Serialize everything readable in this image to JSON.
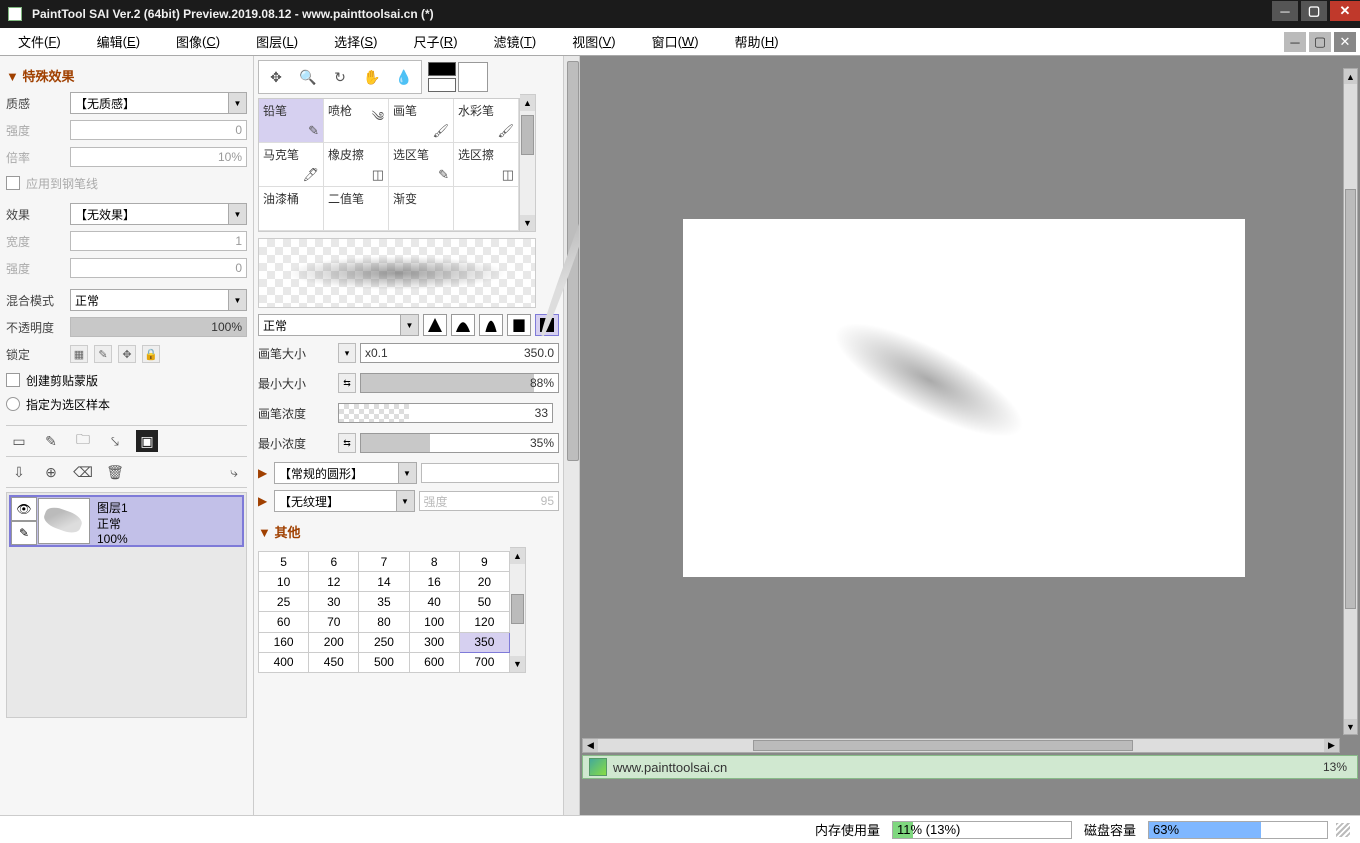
{
  "window": {
    "title": "PaintTool SAI Ver.2 (64bit) Preview.2019.08.12 - www.painttoolsai.cn (*)"
  },
  "menu": {
    "file": {
      "label": "文件",
      "mn": "F"
    },
    "edit": {
      "label": "编辑",
      "mn": "E"
    },
    "image": {
      "label": "图像",
      "mn": "C"
    },
    "layer": {
      "label": "图层",
      "mn": "L"
    },
    "select": {
      "label": "选择",
      "mn": "S"
    },
    "ruler": {
      "label": "尺子",
      "mn": "R"
    },
    "filter": {
      "label": "滤镜",
      "mn": "T"
    },
    "view": {
      "label": "视图",
      "mn": "V"
    },
    "window": {
      "label": "窗口",
      "mn": "W"
    },
    "help": {
      "label": "帮助",
      "mn": "H"
    }
  },
  "left": {
    "special_header": "特殊效果",
    "texture_label": "质感",
    "texture_value": "【无质感】",
    "intensity_label": "强度",
    "intensity_value": "0",
    "scale_label": "倍率",
    "scale_value": "10%",
    "apply_pen_label": "应用到钢笔线",
    "effect_label": "效果",
    "effect_value": "【无效果】",
    "width_label": "宽度",
    "width_value": "1",
    "intensity2_label": "强度",
    "intensity2_value": "0",
    "blend_label": "混合模式",
    "blend_value": "正常",
    "opacity_label": "不透明度",
    "opacity_value": "100%",
    "lock_label": "锁定",
    "clip_label": "创建剪贴蒙版",
    "selsrc_label": "指定为选区样本",
    "layer": {
      "name": "图层1",
      "mode": "正常",
      "opacity": "100%"
    }
  },
  "mid": {
    "brushes": {
      "r1c1": "铅笔",
      "r1c2": "喷枪",
      "r1c3": "画笔",
      "r1c4": "水彩笔",
      "r2c1": "马克笔",
      "r2c2": "橡皮擦",
      "r2c3": "选区笔",
      "r2c4": "选区擦",
      "r3c1": "油漆桶",
      "r3c2": "二值笔",
      "r3c3": "渐变"
    },
    "mode_value": "正常",
    "brush_size_label": "画笔大小",
    "brush_size_prefix": "x0.1",
    "brush_size_value": "350.0",
    "min_size_label": "最小大小",
    "min_size_value": "88%",
    "density_label": "画笔浓度",
    "density_value": "33",
    "min_density_label": "最小浓度",
    "min_density_value": "35%",
    "shape_label": "【常规的圆形】",
    "texture_label": "【无纹理】",
    "texture_intensity_label": "强度",
    "texture_intensity_value": "95",
    "other_header": "其他",
    "sizes": [
      [
        "5",
        "6",
        "7",
        "8",
        "9"
      ],
      [
        "10",
        "12",
        "14",
        "16",
        "20"
      ],
      [
        "25",
        "30",
        "35",
        "40",
        "50"
      ],
      [
        "60",
        "70",
        "80",
        "100",
        "120"
      ],
      [
        "160",
        "200",
        "250",
        "300",
        "350"
      ],
      [
        "400",
        "450",
        "500",
        "600",
        "700"
      ]
    ],
    "size_selected": "350"
  },
  "canvas": {
    "doc_name": "www.painttoolsai.cn",
    "doc_zoom": "13%"
  },
  "status": {
    "mem_label": "内存使用量",
    "mem_text": "11% (13%)",
    "mem_pct": 11,
    "disk_label": "磁盘容量",
    "disk_text": "63%",
    "disk_pct": 63
  }
}
